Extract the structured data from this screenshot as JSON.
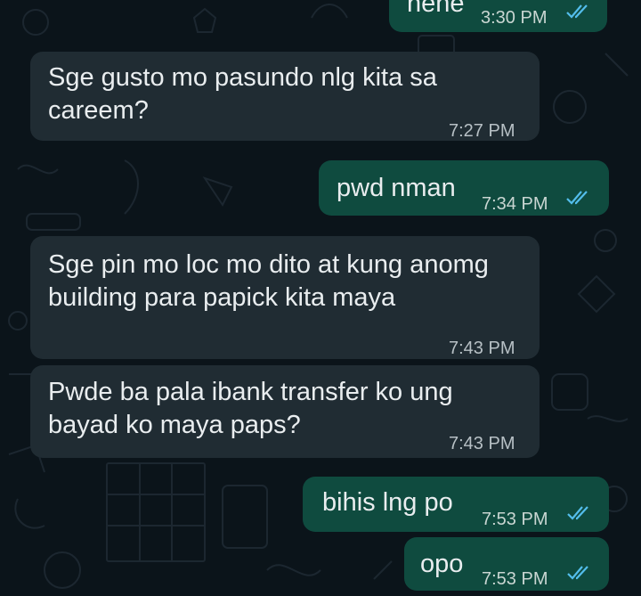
{
  "chat": {
    "messages": [
      {
        "direction": "outgoing",
        "text": "hehe",
        "time": "3:30 PM",
        "status": "read",
        "status_icon": "double-check-icon"
      },
      {
        "direction": "incoming",
        "text": "Sge gusto mo pasundo nlg kita sa careem?",
        "time": "7:27 PM"
      },
      {
        "direction": "outgoing",
        "text": "pwd nman",
        "time": "7:34 PM",
        "status": "read",
        "status_icon": "double-check-icon"
      },
      {
        "direction": "incoming",
        "text": "Sge pin mo loc mo dito at kung anomg building para papick kita maya",
        "time": "7:43 PM"
      },
      {
        "direction": "incoming",
        "text": "Pwde ba pala ibank transfer ko ung bayad ko maya paps?",
        "time": "7:43 PM"
      },
      {
        "direction": "outgoing",
        "text": "bihis lng po",
        "time": "7:53 PM",
        "status": "read",
        "status_icon": "double-check-icon"
      },
      {
        "direction": "outgoing",
        "text": "opo",
        "time": "7:53 PM",
        "status": "read",
        "status_icon": "double-check-icon"
      }
    ]
  },
  "colors": {
    "background": "#0b141a",
    "incoming_bubble": "#202c33",
    "outgoing_bubble": "#0f4b3f",
    "read_ticks": "#53bdeb"
  }
}
